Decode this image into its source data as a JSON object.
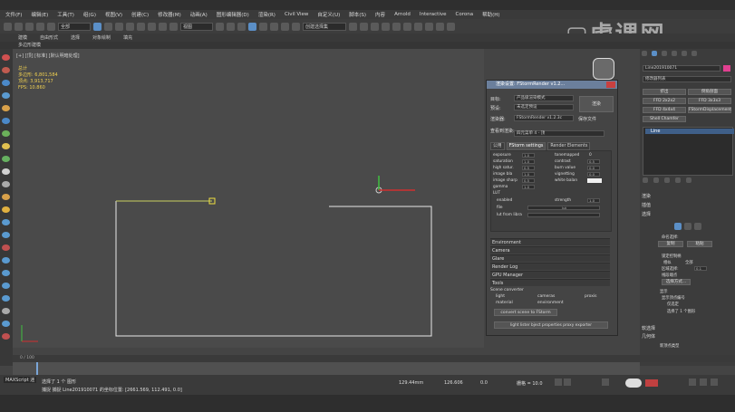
{
  "menu": [
    "文件(F)",
    "编辑(E)",
    "工具(T)",
    "组(G)",
    "视图(V)",
    "创建(C)",
    "修改器(M)",
    "动画(A)",
    "图形编辑器(D)",
    "渲染(R)",
    "Civil View",
    "自定义(U)",
    "脚本(S)",
    "内容",
    "Arnold",
    "Interactive",
    "Corona",
    "帮助(H)"
  ],
  "toolbar": {
    "selection_filter": "全部",
    "viewport_type": "视图",
    "named_set": "创建选择集"
  },
  "ribbon_tabs": [
    "建模",
    "自由形式",
    "选择",
    "对象绘制",
    "填充"
  ],
  "ribbon_sub": "多边形建模",
  "viewport": {
    "label": "[+] [顶] [标准] [默认明暗处理]",
    "stats": [
      "总计",
      "多边形: 6,801,584",
      "顶点: 3,913,717",
      "FPS: 10.860"
    ]
  },
  "dialog": {
    "title": "渲染设置: FStormRender v1.2...",
    "target_label": "目标:",
    "target_value": "产品级渲染模式",
    "preset_label": "预设:",
    "preset_value": "未选定预设",
    "renderer_label": "渲染器:",
    "renderer_value": "FStormRender v1.2.3c",
    "save_file": "保存文件",
    "view_label": "查看到渲染:",
    "view_value": "四元菜单 4 - 顶",
    "render_button": "渲染",
    "tabs": [
      "公用",
      "FStorm settings",
      "Render Elements"
    ],
    "params_left": [
      {
        "label": "exposure",
        "value": "1.0"
      },
      {
        "label": "saturation",
        "value": "1.0"
      },
      {
        "label": "high satur.",
        "value": "0.5"
      },
      {
        "label": "image bla",
        "value": "1.0"
      },
      {
        "label": "image sharp",
        "value": "0.5"
      },
      {
        "label": "gamma",
        "value": "1.0"
      },
      {
        "label": "LUT",
        "value": ""
      }
    ],
    "params_right": [
      {
        "label": "tonemapped",
        "value": "0"
      },
      {
        "label": "contrast",
        "value": "0.5"
      },
      {
        "label": "burn value",
        "value": "0.0"
      },
      {
        "label": "vignetting",
        "value": "0.0"
      },
      {
        "label": "white balan",
        "value": ""
      }
    ],
    "lut_enabled": "enabled",
    "lut_strength": "strength",
    "lut_strength_value": "1.0",
    "lut_file": "file",
    "lut_file_value": "lut",
    "lut_list": "lut from libra",
    "rollouts": [
      "Environment",
      "Camera",
      "Glare",
      "Render Log",
      "GPU Manager",
      "Tools"
    ],
    "tools_title": "Scene converter",
    "tools_row1": [
      "light",
      "cameras",
      "proxis"
    ],
    "tools_row2": [
      "material",
      "environment"
    ],
    "convert_button": "convert scene to FStorm",
    "tools_bottom": "light lister  bject properties proxy exporter"
  },
  "right_panel": {
    "object_name": "Line201910071",
    "modifier_list": "修改器列表",
    "mod_buttons": [
      "挤出",
      "倒角剖面",
      "FFD 2x2x2",
      "FFD 3x3x3",
      "FFD 4x4x4",
      "FStormDisplacement",
      "Shell Chamfer"
    ],
    "stack_item": "Line",
    "rollouts": [
      "渲染",
      "插值",
      "选择"
    ],
    "selection_labels": [
      "命名选择:",
      "复制",
      "粘贴"
    ],
    "lock_handles": "锁定控制柄",
    "similar": "相似",
    "all": "全部",
    "area_select": "区域选择:",
    "area_value": "0.1",
    "segment_end": "线段端点",
    "select_by": "选择方式...",
    "display": "显示",
    "show_vertex_numbers": "显示顶点编号",
    "only_selected": "仅选定",
    "selected_count": "选择了 1 个图形",
    "soft_select": "软选择",
    "geometry": "几何体",
    "new_vertex_type": "新顶点类型"
  },
  "timeline": {
    "frame": "0 / 100"
  },
  "status": {
    "selected": "选择了 1 个 图形",
    "prompt": "捕捉 捕捉 Line201910071 的坐标位置: [2661.569, 112.491, 0.0]",
    "maxscript": "MAXScript 迷",
    "x": "129.44mm",
    "y": "126.606",
    "z": "0.0",
    "grid": "栅格 = 10.0"
  }
}
